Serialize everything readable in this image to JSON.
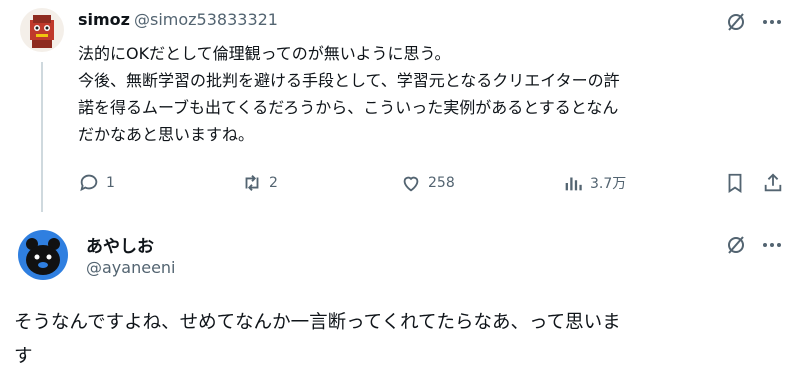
{
  "tweet1": {
    "name": "simoz",
    "handle": "@simoz53833321",
    "lines": [
      "法的にOKだとして倫理観ってのが無いように思う。",
      "今後、無断学習の批判を避ける手段として、学習元となるクリエイターの許",
      "諾を得るムーブも出てくるだろうから、こういった実例があるとするとなん",
      "だかなあと思いますね。"
    ],
    "replies": "1",
    "retweets": "2",
    "likes": "258",
    "views": "3.7万",
    "icons": [
      "grok-icon",
      "more-icon",
      "reply-icon",
      "retweet-icon",
      "like-icon",
      "views-icon",
      "bookmark-icon",
      "share-icon"
    ]
  },
  "tweet2": {
    "name": "あやしお",
    "handle": "@ayaneeni",
    "lines": [
      "そうなんですよね、せめてなんか一言断ってくれてたらなあ、って思いま",
      "す"
    ],
    "icons": [
      "grok-icon",
      "more-icon"
    ]
  },
  "colors": {
    "text": "#0f1419",
    "secondary": "#536471",
    "thread_line": "#cfd9de",
    "avatar2_bg": "#2f7fe0"
  }
}
